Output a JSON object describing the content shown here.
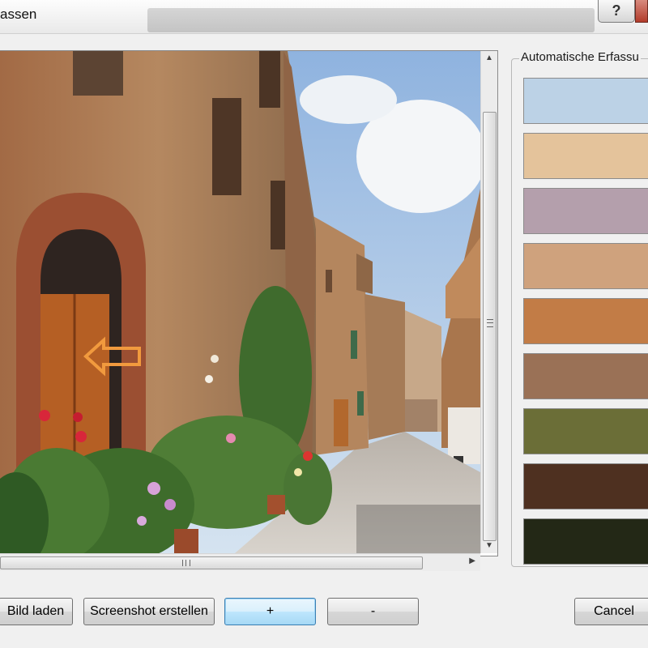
{
  "window": {
    "title": "assen",
    "help_label": "?"
  },
  "palette": {
    "title": "Automatische Erfassu",
    "colors": [
      "#bcd2e6",
      "#e4c39b",
      "#b49fac",
      "#cfa27d",
      "#c27c46",
      "#9a7156",
      "#6b6e37",
      "#4e3020",
      "#232816"
    ]
  },
  "buttons": {
    "load": "Bild laden",
    "screenshot": "Screenshot erstellen",
    "add": "+",
    "remove": "-",
    "cancel": "Cancel"
  },
  "scroll_icons": {
    "up": "scroll-up-arrow-icon",
    "down": "scroll-down-arrow-icon",
    "right": "scroll-right-arrow-icon"
  }
}
